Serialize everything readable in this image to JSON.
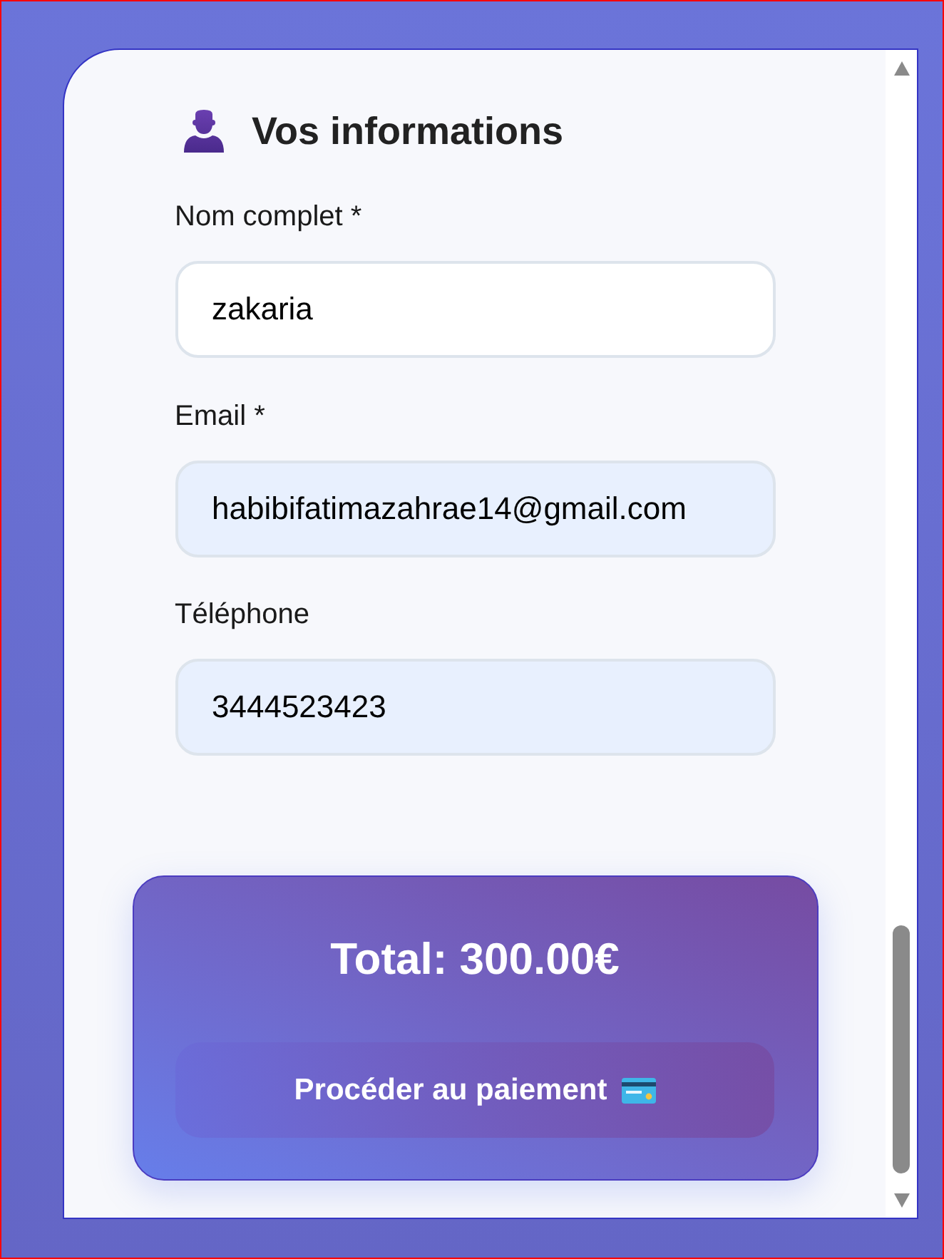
{
  "section": {
    "title": "Vos informations"
  },
  "fields": [
    {
      "label": "Nom complet *",
      "value": "zakaria",
      "autofilled": false
    },
    {
      "label": "Email *",
      "value": "habibifatimazahrae14@gmail.com",
      "autofilled": true
    },
    {
      "label": "Téléphone",
      "value": "3444523423",
      "autofilled": true
    }
  ],
  "summary": {
    "total": "Total: 300.00€",
    "button": "Procéder au paiement"
  }
}
